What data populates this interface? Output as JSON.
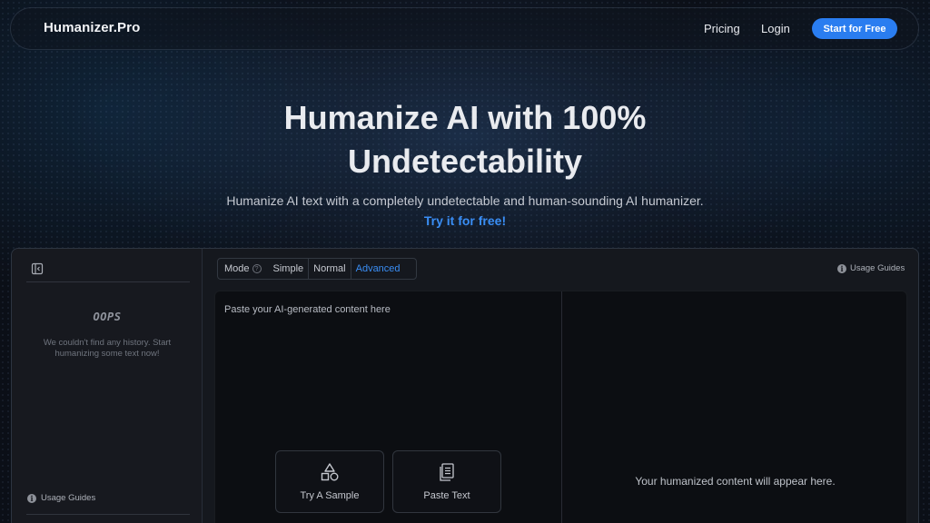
{
  "nav": {
    "brand": "Humanizer.Pro",
    "pricing": "Pricing",
    "login": "Login",
    "cta": "Start for Free"
  },
  "hero": {
    "title_line1": "Humanize AI with 100%",
    "title_line2": "Undetectability",
    "subtitle": "Humanize AI text with a completely undetectable and human-sounding AI humanizer.",
    "try_link": "Try it for free!"
  },
  "sidebar": {
    "oops": "OOPS",
    "empty_message": "We couldn't find any history. Start humanizing some text now!",
    "usage_guides": "Usage Guides"
  },
  "mode": {
    "label": "Mode",
    "options": [
      "Simple",
      "Normal",
      "Advanced"
    ],
    "selected": "Advanced"
  },
  "toolbar": {
    "usage_guides": "Usage Guides"
  },
  "editor": {
    "input_value": "",
    "input_placeholder": "Paste your AI-generated content here",
    "try_sample": "Try A Sample",
    "paste_text": "Paste Text",
    "output_placeholder": "Your humanized content will appear here."
  },
  "colors": {
    "accent": "#2a7df0",
    "link": "#3a8ef5",
    "background": "#0b0f17",
    "panel": "#15181e",
    "editor": "#0c0e12"
  },
  "icons": {
    "collapse": "sidebar-collapse-icon",
    "info": "info-icon",
    "help": "question-icon",
    "sample": "shapes-icon",
    "paste": "clipboard-icon"
  }
}
